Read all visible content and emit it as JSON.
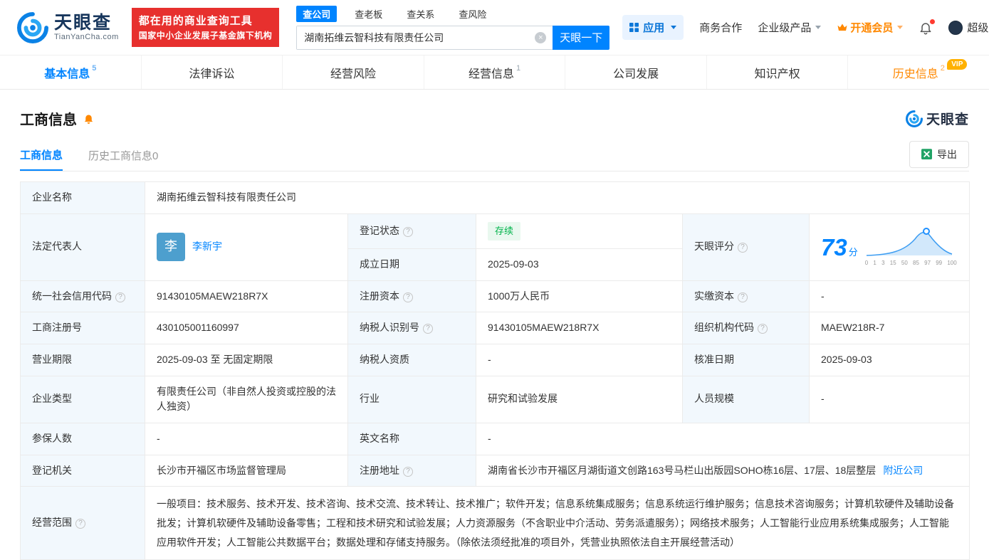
{
  "logo": {
    "brand": "天眼查",
    "domain": "TianYanCha.com"
  },
  "icons": {
    "info": "?",
    "clear": "×"
  },
  "header": {
    "promo": {
      "line1": "都在用的商业查询工具",
      "line2": "国家中小企业发展子基金旗下机构"
    },
    "search": {
      "tabs": [
        {
          "label": "查公司"
        },
        {
          "label": "查老板"
        },
        {
          "label": "查关系"
        },
        {
          "label": "查风险"
        }
      ],
      "value": "湖南拓维云智科技有限责任公司",
      "button": "天眼一下"
    },
    "nav": {
      "apps": "应用",
      "cooperation": "商务合作",
      "products": "企业级产品",
      "vip": "开通会员",
      "user": "超级..."
    }
  },
  "tabs": [
    {
      "label": "基本信息",
      "count": "5"
    },
    {
      "label": "法律诉讼",
      "count": ""
    },
    {
      "label": "经营风险",
      "count": ""
    },
    {
      "label": "经营信息",
      "count": "1"
    },
    {
      "label": "公司发展",
      "count": ""
    },
    {
      "label": "知识产权",
      "count": ""
    },
    {
      "label": "历史信息",
      "count": "2",
      "badge": "VIP"
    }
  ],
  "section": {
    "title": "工商信息",
    "brand": "天眼查",
    "subtabs": [
      {
        "label": "工商信息"
      },
      {
        "label": "历史工商信息0"
      }
    ],
    "export": "导出"
  },
  "score": {
    "label": "天眼评分",
    "value": "73",
    "unit": "分",
    "axis": "0 1 3 15 50 85 97 99 100"
  },
  "fields": {
    "company_name": {
      "label": "企业名称",
      "value": "湖南拓维云智科技有限责任公司"
    },
    "legal_rep": {
      "label": "法定代表人",
      "avatar": "李",
      "name": "李新宇"
    },
    "reg_status": {
      "label": "登记状态",
      "value": "存续"
    },
    "establish_date": {
      "label": "成立日期",
      "value": "2025-09-03"
    },
    "credit_code": {
      "label": "统一社会信用代码",
      "value": "91430105MAEW218R7X"
    },
    "reg_capital": {
      "label": "注册资本",
      "value": "1000万人民币"
    },
    "paid_capital": {
      "label": "实缴资本",
      "value": "-"
    },
    "reg_number": {
      "label": "工商注册号",
      "value": "430105001160997"
    },
    "taxpayer_id": {
      "label": "纳税人识别号",
      "value": "91430105MAEW218R7X"
    },
    "org_code": {
      "label": "组织机构代码",
      "value": "MAEW218R-7"
    },
    "business_term": {
      "label": "营业期限",
      "value": "2025-09-03 至 无固定期限"
    },
    "taxpayer_quality": {
      "label": "纳税人资质",
      "value": "-"
    },
    "approval_date": {
      "label": "核准日期",
      "value": "2025-09-03"
    },
    "company_type": {
      "label": "企业类型",
      "value": "有限责任公司（非自然人投资或控股的法人独资）"
    },
    "industry": {
      "label": "行业",
      "value": "研究和试验发展"
    },
    "staff_size": {
      "label": "人员规模",
      "value": "-"
    },
    "insured_count": {
      "label": "参保人数",
      "value": "-"
    },
    "english_name": {
      "label": "英文名称",
      "value": "-"
    },
    "reg_authority": {
      "label": "登记机关",
      "value": "长沙市开福区市场监督管理局"
    },
    "reg_address": {
      "label": "注册地址",
      "value": "湖南省长沙市开福区月湖街道文创路163号马栏山出版园SOHO栋16层、17层、18层整层",
      "link": "附近公司"
    },
    "business_scope": {
      "label": "经营范围",
      "value": "一般项目：技术服务、技术开发、技术咨询、技术交流、技术转让、技术推广；软件开发；信息系统集成服务；信息系统运行维护服务；信息技术咨询服务；计算机软硬件及辅助设备批发；计算机软硬件及辅助设备零售；工程和技术研究和试验发展；人力资源服务（不含职业中介活动、劳务派遣服务）；网络技术服务；人工智能行业应用系统集成服务；人工智能应用软件开发；人工智能公共数据平台；数据处理和存储支持服务。（除依法须经批准的项目外，凭营业执照依法自主开展经营活动）"
    }
  },
  "colors": {
    "accent": "#0084ff",
    "red": "#e7302e",
    "orange": "#ff8800",
    "green": "#00b34a"
  }
}
